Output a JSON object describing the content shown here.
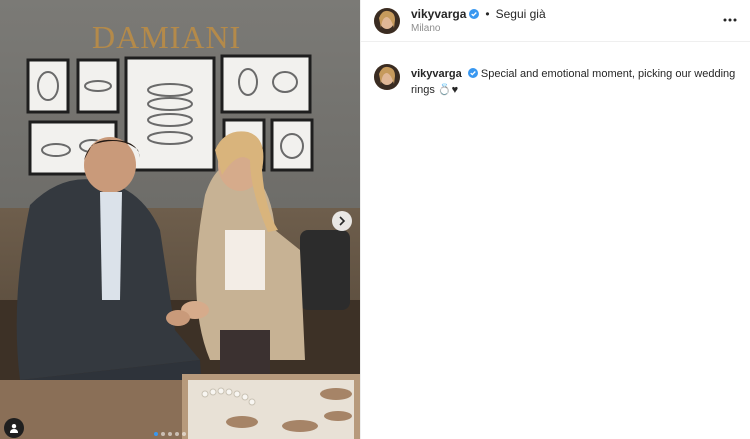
{
  "post": {
    "author": {
      "username": "vikyvarga",
      "verified": true,
      "follow_label": "Segui già",
      "separator": "•",
      "location": "Milano"
    },
    "caption": {
      "username": "vikyvarga",
      "text": "Special and emotional moment, picking our wedding rings 💍♥"
    },
    "photo": {
      "brand_text": "DAMIANI",
      "carousel_dots": 5,
      "active_dot": 0
    },
    "icons": {
      "more": "more-horizontal-icon",
      "next": "chevron-right-icon",
      "tag": "user-tag-icon",
      "verified": "verified-badge-icon"
    },
    "colors": {
      "verified_blue": "#3897f0",
      "secondary_text": "#8e8e8e",
      "text": "#262626"
    }
  }
}
